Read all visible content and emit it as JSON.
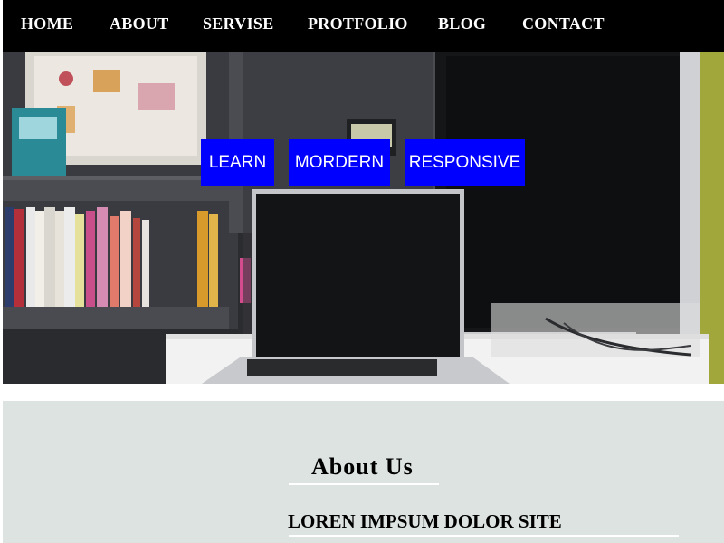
{
  "nav": {
    "items": [
      "HOME",
      "ABOUT",
      "SERVISE",
      "PROTFOLIO",
      "BLOG",
      "CONTACT"
    ]
  },
  "hero": {
    "buttons": [
      "LEARN",
      "MORDERN",
      "RESPONSIVE"
    ],
    "button_color": "#0000ff"
  },
  "about": {
    "title": "About Us",
    "subtitle": "LOREN IMPSUM DOLOR SITE",
    "background": "#dce3e1"
  }
}
